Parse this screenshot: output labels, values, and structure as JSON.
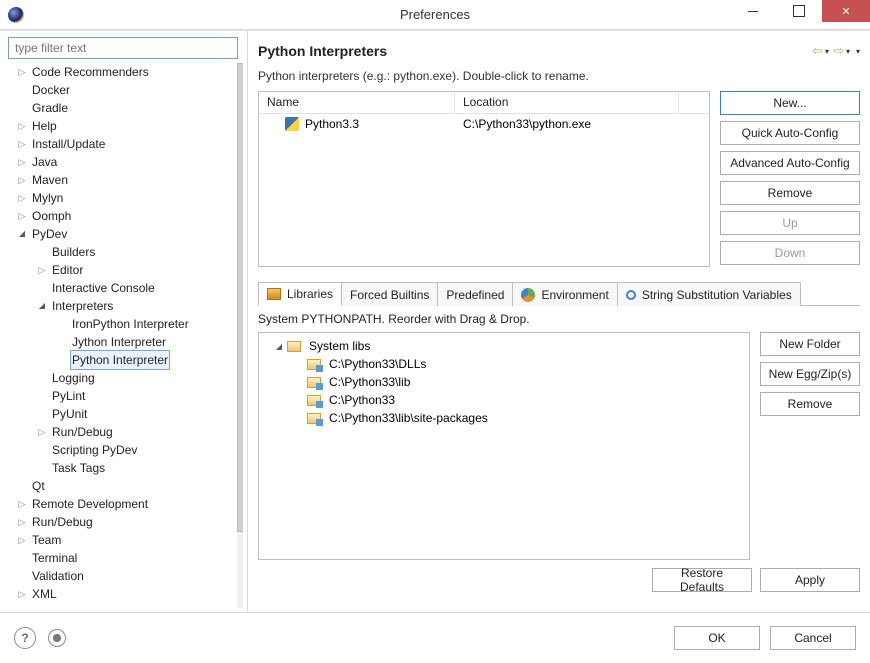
{
  "window": {
    "title": "Preferences"
  },
  "filter": {
    "placeholder": "type filter text"
  },
  "tree": [
    {
      "depth": 0,
      "tw": "closed",
      "label": "Code Recommenders"
    },
    {
      "depth": 0,
      "tw": "none",
      "label": "Docker"
    },
    {
      "depth": 0,
      "tw": "none",
      "label": "Gradle"
    },
    {
      "depth": 0,
      "tw": "closed",
      "label": "Help"
    },
    {
      "depth": 0,
      "tw": "closed",
      "label": "Install/Update"
    },
    {
      "depth": 0,
      "tw": "closed",
      "label": "Java"
    },
    {
      "depth": 0,
      "tw": "closed",
      "label": "Maven"
    },
    {
      "depth": 0,
      "tw": "closed",
      "label": "Mylyn"
    },
    {
      "depth": 0,
      "tw": "closed",
      "label": "Oomph"
    },
    {
      "depth": 0,
      "tw": "open",
      "label": "PyDev"
    },
    {
      "depth": 1,
      "tw": "none",
      "label": "Builders"
    },
    {
      "depth": 1,
      "tw": "closed",
      "label": "Editor"
    },
    {
      "depth": 1,
      "tw": "none",
      "label": "Interactive Console"
    },
    {
      "depth": 1,
      "tw": "open",
      "label": "Interpreters"
    },
    {
      "depth": 2,
      "tw": "none",
      "label": "IronPython Interpreter"
    },
    {
      "depth": 2,
      "tw": "none",
      "label": "Jython Interpreter"
    },
    {
      "depth": 2,
      "tw": "none",
      "label": "Python Interpreter",
      "selected": true
    },
    {
      "depth": 1,
      "tw": "none",
      "label": "Logging"
    },
    {
      "depth": 1,
      "tw": "none",
      "label": "PyLint"
    },
    {
      "depth": 1,
      "tw": "none",
      "label": "PyUnit"
    },
    {
      "depth": 1,
      "tw": "closed",
      "label": "Run/Debug"
    },
    {
      "depth": 1,
      "tw": "none",
      "label": "Scripting PyDev"
    },
    {
      "depth": 1,
      "tw": "none",
      "label": "Task Tags"
    },
    {
      "depth": 0,
      "tw": "none",
      "label": "Qt"
    },
    {
      "depth": 0,
      "tw": "closed",
      "label": "Remote Development"
    },
    {
      "depth": 0,
      "tw": "closed",
      "label": "Run/Debug"
    },
    {
      "depth": 0,
      "tw": "closed",
      "label": "Team"
    },
    {
      "depth": 0,
      "tw": "none",
      "label": "Terminal"
    },
    {
      "depth": 0,
      "tw": "none",
      "label": "Validation"
    },
    {
      "depth": 0,
      "tw": "closed",
      "label": "XML"
    }
  ],
  "page": {
    "title": "Python Interpreters",
    "description": "Python interpreters (e.g.: python.exe).   Double-click to rename."
  },
  "interpTable": {
    "headers": {
      "name": "Name",
      "location": "Location"
    },
    "rows": [
      {
        "name": "Python3.3",
        "location": "C:\\Python33\\python.exe"
      }
    ]
  },
  "interpButtons": {
    "new": "New...",
    "quick": "Quick Auto-Config",
    "advanced": "Advanced Auto-Config",
    "remove": "Remove",
    "up": "Up",
    "down": "Down"
  },
  "tabs": {
    "libraries": "Libraries",
    "forced": "Forced Builtins",
    "predefined": "Predefined",
    "environment": "Environment",
    "stringsub": "String Substitution Variables"
  },
  "libs": {
    "description": "System PYTHONPATH.   Reorder with Drag & Drop.",
    "root": "System libs",
    "items": [
      "C:\\Python33\\DLLs",
      "C:\\Python33\\lib",
      "C:\\Python33",
      "C:\\Python33\\lib\\site-packages"
    ],
    "buttons": {
      "newFolder": "New Folder",
      "newEgg": "New Egg/Zip(s)",
      "remove": "Remove"
    }
  },
  "footer": {
    "restore": "Restore Defaults",
    "apply": "Apply"
  },
  "bottom": {
    "ok": "OK",
    "cancel": "Cancel"
  }
}
